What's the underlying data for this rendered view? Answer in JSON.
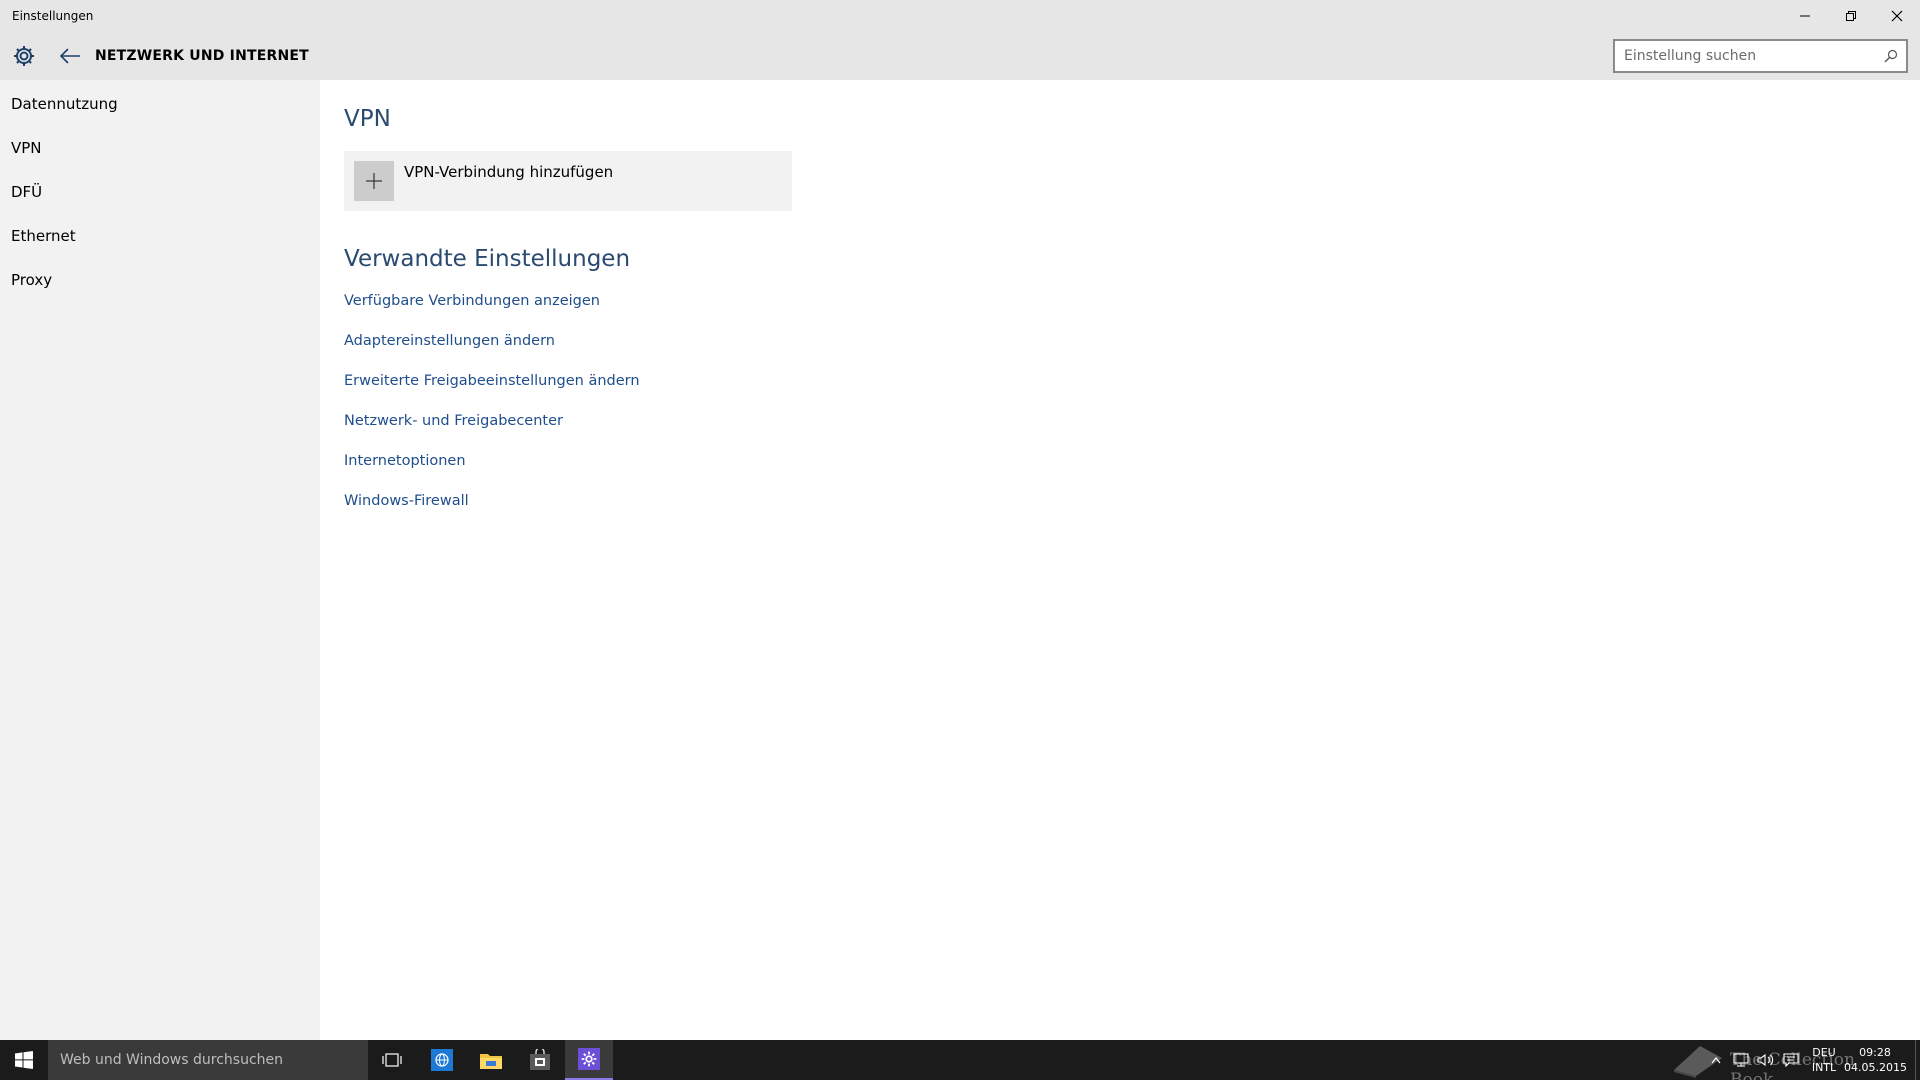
{
  "window": {
    "title": "Einstellungen"
  },
  "header": {
    "page_title": "NETZWERK UND INTERNET",
    "search_placeholder": "Einstellung suchen"
  },
  "sidebar": {
    "items": [
      {
        "label": "Datennutzung"
      },
      {
        "label": "VPN"
      },
      {
        "label": "DFÜ"
      },
      {
        "label": "Ethernet"
      },
      {
        "label": "Proxy"
      }
    ]
  },
  "main": {
    "vpn_heading": "VPN",
    "add_vpn_label": "VPN-Verbindung hinzufügen",
    "related_heading": "Verwandte Einstellungen",
    "related_links": [
      {
        "label": "Verfügbare Verbindungen anzeigen"
      },
      {
        "label": "Adaptereinstellungen ändern"
      },
      {
        "label": "Erweiterte Freigabeeinstellungen ändern"
      },
      {
        "label": "Netzwerk- und Freigabecenter"
      },
      {
        "label": "Internetoptionen"
      },
      {
        "label": "Windows-Firewall"
      }
    ]
  },
  "taskbar": {
    "search_placeholder": "Web und Windows durchsuchen",
    "watermark": "The Collection Book",
    "lang_top": "DEU",
    "lang_bottom": "INTL",
    "time": "09:28",
    "date": "04.05.2015"
  },
  "colors": {
    "accent_heading": "#2a4a6f",
    "link": "#1f4e8c",
    "active_app_indicator": "#8c7ae6"
  }
}
